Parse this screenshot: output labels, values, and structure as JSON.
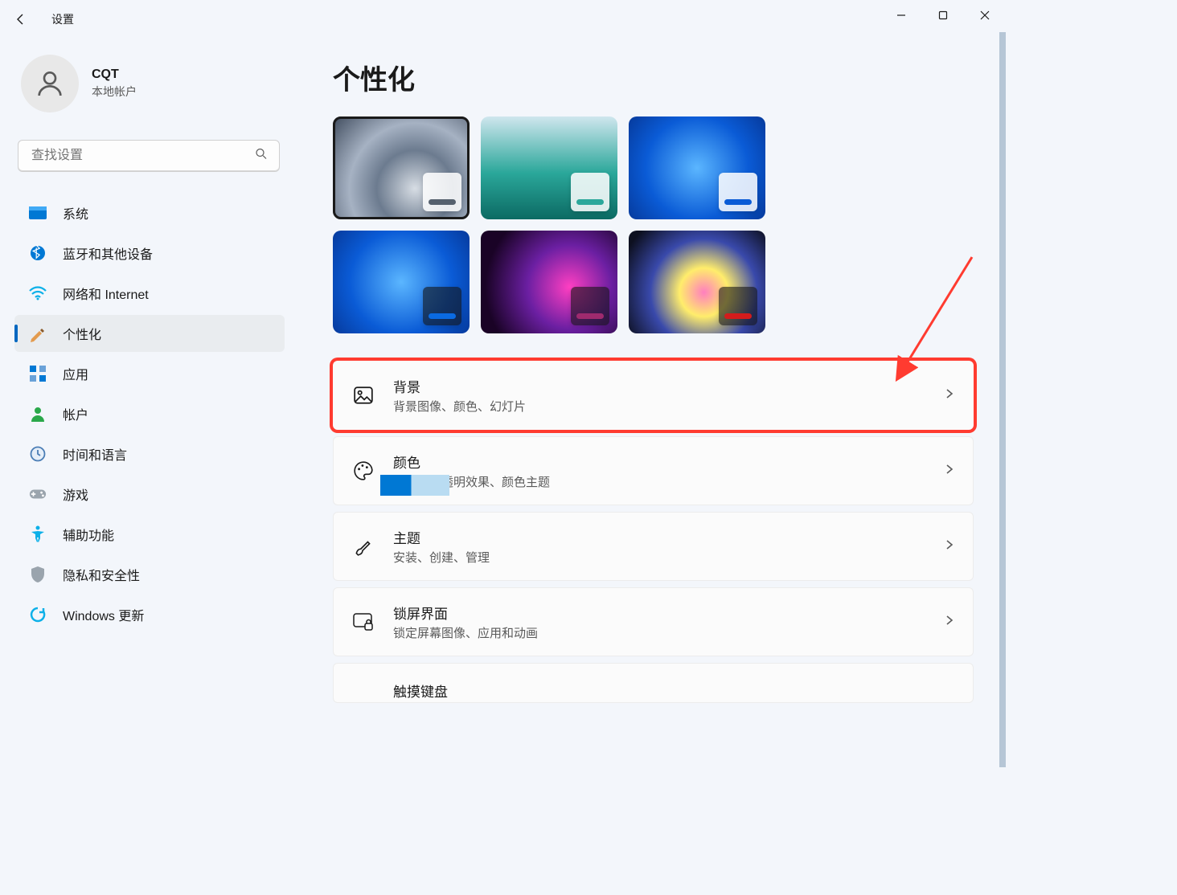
{
  "window": {
    "title": "设置"
  },
  "profile": {
    "name": "CQT",
    "subtitle": "本地帐户"
  },
  "search": {
    "placeholder": "查找设置"
  },
  "nav": {
    "system": "系统",
    "bluetooth": "蓝牙和其他设备",
    "network": "网络和 Internet",
    "personalization": "个性化",
    "apps": "应用",
    "accounts": "帐户",
    "time": "时间和语言",
    "gaming": "游戏",
    "accessibility": "辅助功能",
    "privacy": "隐私和安全性",
    "update": "Windows 更新"
  },
  "page": {
    "title": "个性化"
  },
  "themes": [
    {
      "bg": "radial-gradient(circle at 60% 70%, #d7dde4 0%, #6c7b8f 35%, #a6b2c3 60%, #3e4a5c 100%)",
      "bar": "#56616e",
      "selected": true,
      "overlay": "light"
    },
    {
      "bg": "linear-gradient(180deg,#cfe6ee 0%,#2aa79a 55%,#0c6a63 100%)",
      "bar": "#2aa79a",
      "selected": false,
      "overlay": "light"
    },
    {
      "bg": "radial-gradient(circle at 50% 50%, #5bb6ff 0%, #0a5bd6 60%, #063a9c 100%)",
      "bar": "#0a5bd6",
      "selected": false,
      "overlay": "light"
    },
    {
      "bg": "radial-gradient(circle at 50% 50%, #5bb6ff 0%, #0a5bd6 60%, #063a9c 100%)",
      "bar": "#0a6ae2",
      "selected": false,
      "overlay": "dark"
    },
    {
      "bg": "radial-gradient(circle at 65% 55%, #ff3fc2 0%, #6b1fa2 40%, #1a0326 80%)",
      "bar": "#9e2a6e",
      "selected": false,
      "overlay": "dark"
    },
    {
      "bg": "radial-gradient(circle at 55% 60%, #ff7fbf 0%, #ffed6b 25%, #3949ab 55%, #0d1020 90%)",
      "bar": "#d31c1c",
      "selected": false,
      "overlay": "dark"
    }
  ],
  "cards": {
    "background": {
      "title": "背景",
      "sub": "背景图像、颜色、幻灯片"
    },
    "colors": {
      "title": "颜色",
      "sub": "主题色、透明效果、颜色主题"
    },
    "themes": {
      "title": "主题",
      "sub": "安装、创建、管理"
    },
    "lockscreen": {
      "title": "锁屏界面",
      "sub": "锁定屏幕图像、应用和动画"
    },
    "touchkbd": {
      "title": "触摸键盘"
    }
  }
}
